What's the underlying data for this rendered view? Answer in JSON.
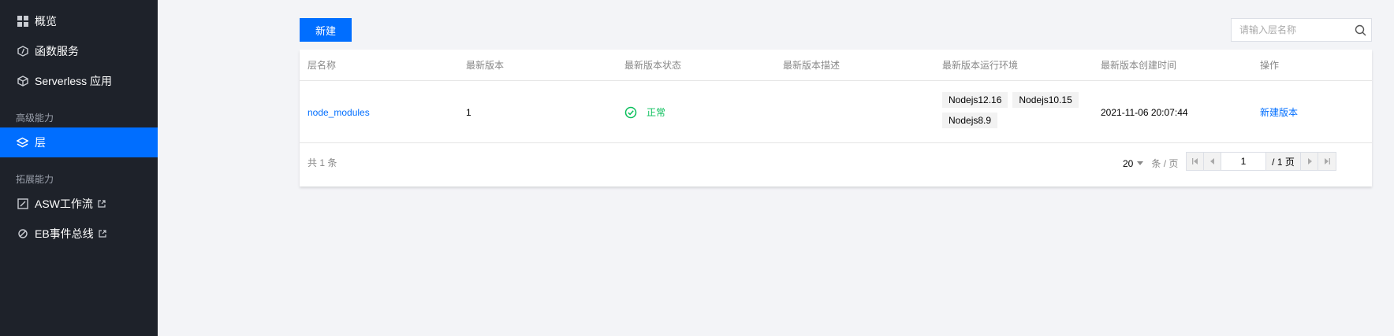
{
  "sidebar": {
    "items": [
      {
        "label": "概览",
        "icon": "grid-icon"
      },
      {
        "label": "函数服务",
        "icon": "function-icon"
      },
      {
        "label": "Serverless 应用",
        "icon": "cube-icon"
      }
    ],
    "group_advanced": "高级能力",
    "layer": {
      "label": "层",
      "icon": "layers-icon"
    },
    "group_extension": "拓展能力",
    "ext_items": [
      {
        "label": "ASW工作流",
        "icon": "workflow-icon"
      },
      {
        "label": "EB事件总线",
        "icon": "eventbus-icon"
      }
    ]
  },
  "toolbar": {
    "new_button": "新建",
    "search_placeholder": "请输入层名称"
  },
  "table": {
    "columns": [
      "层名称",
      "最新版本",
      "最新版本状态",
      "最新版本描述",
      "最新版本运行环境",
      "最新版本创建时间",
      "操作"
    ],
    "row": {
      "name": "node_modules",
      "version": "1",
      "status": "正常",
      "description": "",
      "runtimes": [
        "Nodejs12.16",
        "Nodejs10.15",
        "Nodejs8.9"
      ],
      "created": "2021-11-06 20:07:44",
      "action": "新建版本"
    }
  },
  "footer": {
    "total": "共 1 条",
    "page_size": "20",
    "page_size_unit": "条 / 页",
    "current_page": "1",
    "total_pages": "/ 1 页"
  },
  "colors": {
    "sidebar_bg": "#1e222a",
    "accent": "#006eff",
    "success": "#0abf5b",
    "page_bg": "#f3f4f7"
  }
}
